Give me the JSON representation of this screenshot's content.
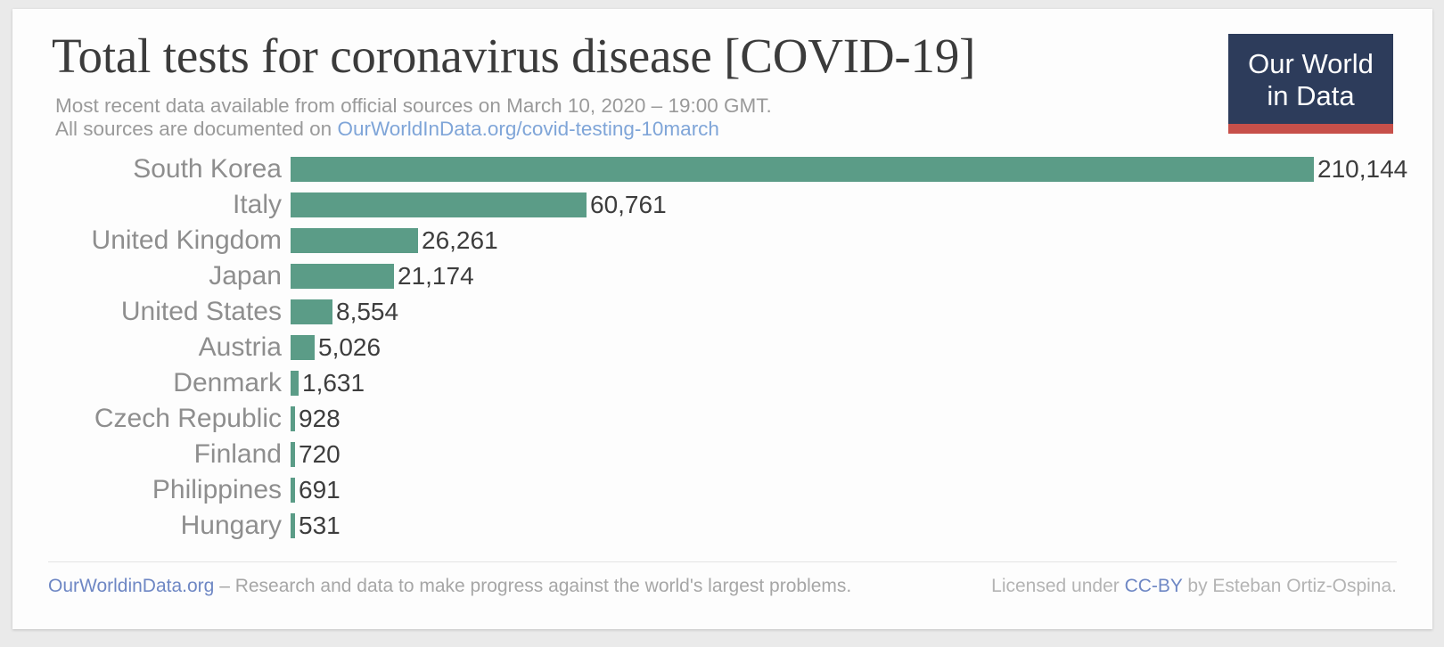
{
  "header": {
    "title": "Total tests for coronavirus disease [COVID-19]",
    "subtitle_line1": "Most recent data available from official sources on March 10, 2020 – 19:00 GMT.",
    "subtitle_line2_prefix": "All sources are documented on ",
    "subtitle_link": "OurWorldInData.org/covid-testing-10march"
  },
  "logo": {
    "line1": "Our World",
    "line2": "in Data",
    "box_color": "#2d3c5b",
    "rule_color": "#c7504a",
    "text_color": "#ffffff"
  },
  "footer": {
    "site_link": "OurWorldinData.org",
    "tagline": "– Research and data to make progress against the world's largest problems.",
    "license_prefix": "Licensed under ",
    "license_link": "CC-BY",
    "license_suffix": " by Esteban Ortiz-Ospina."
  },
  "chart_data": {
    "type": "bar",
    "orientation": "horizontal",
    "title": "Total tests for coronavirus disease [COVID-19]",
    "subtitle": "Most recent data available from official sources on March 10, 2020 – 19:00 GMT.",
    "xlabel": "",
    "ylabel": "",
    "grid": false,
    "legend": null,
    "bar_color": "#5b9c87",
    "xlim": [
      0,
      210144
    ],
    "categories": [
      "South Korea",
      "Italy",
      "United Kingdom",
      "Japan",
      "United States",
      "Austria",
      "Denmark",
      "Czech Republic",
      "Finland",
      "Philippines",
      "Hungary"
    ],
    "values": [
      210144,
      60761,
      26261,
      21174,
      8554,
      5026,
      1631,
      928,
      720,
      691,
      531
    ],
    "value_labels": [
      "210,144",
      "60,761",
      "26,261",
      "21,174",
      "8,554",
      "5,026",
      "1,631",
      "928",
      "720",
      "691",
      "531"
    ]
  }
}
